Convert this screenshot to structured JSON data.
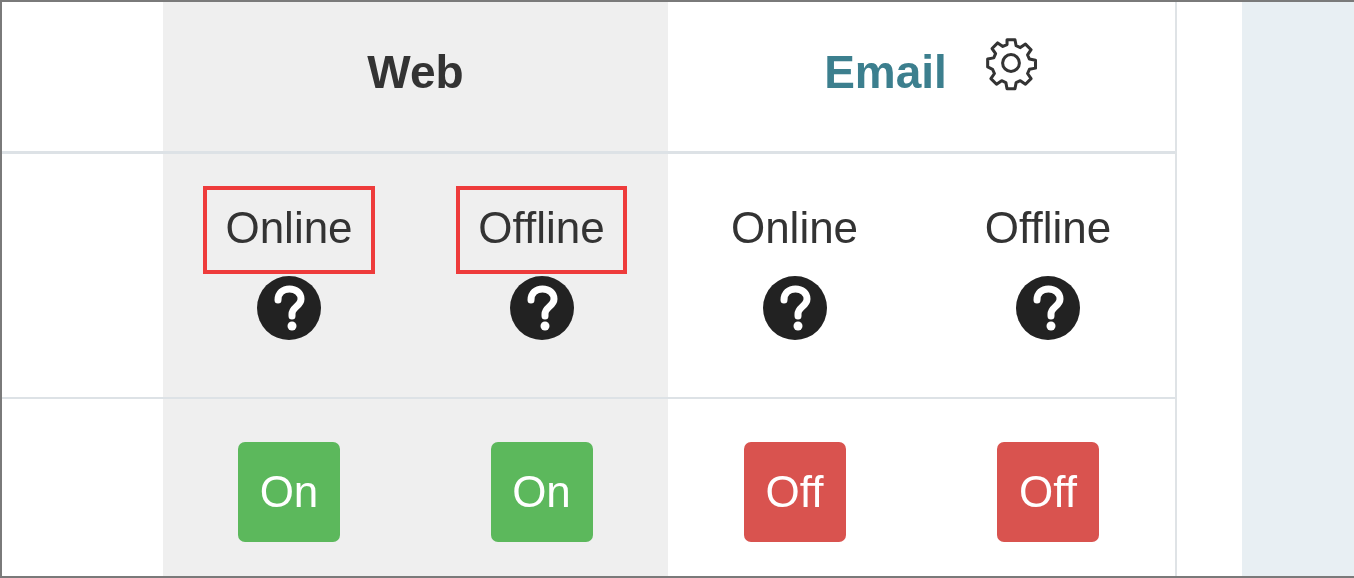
{
  "channels": [
    {
      "label": "Web",
      "kind": "plain",
      "shaded": true
    },
    {
      "label": "Email",
      "kind": "settings",
      "shaded": false
    }
  ],
  "modes": [
    {
      "label": "Online",
      "highlighted": true
    },
    {
      "label": "Offline",
      "highlighted": true
    },
    {
      "label": "Online",
      "highlighted": false
    },
    {
      "label": "Offline",
      "highlighted": false
    }
  ],
  "toggles": [
    {
      "label": "On",
      "on": true
    },
    {
      "label": "On",
      "on": true
    },
    {
      "label": "Off",
      "on": false
    },
    {
      "label": "Off",
      "on": false
    }
  ]
}
